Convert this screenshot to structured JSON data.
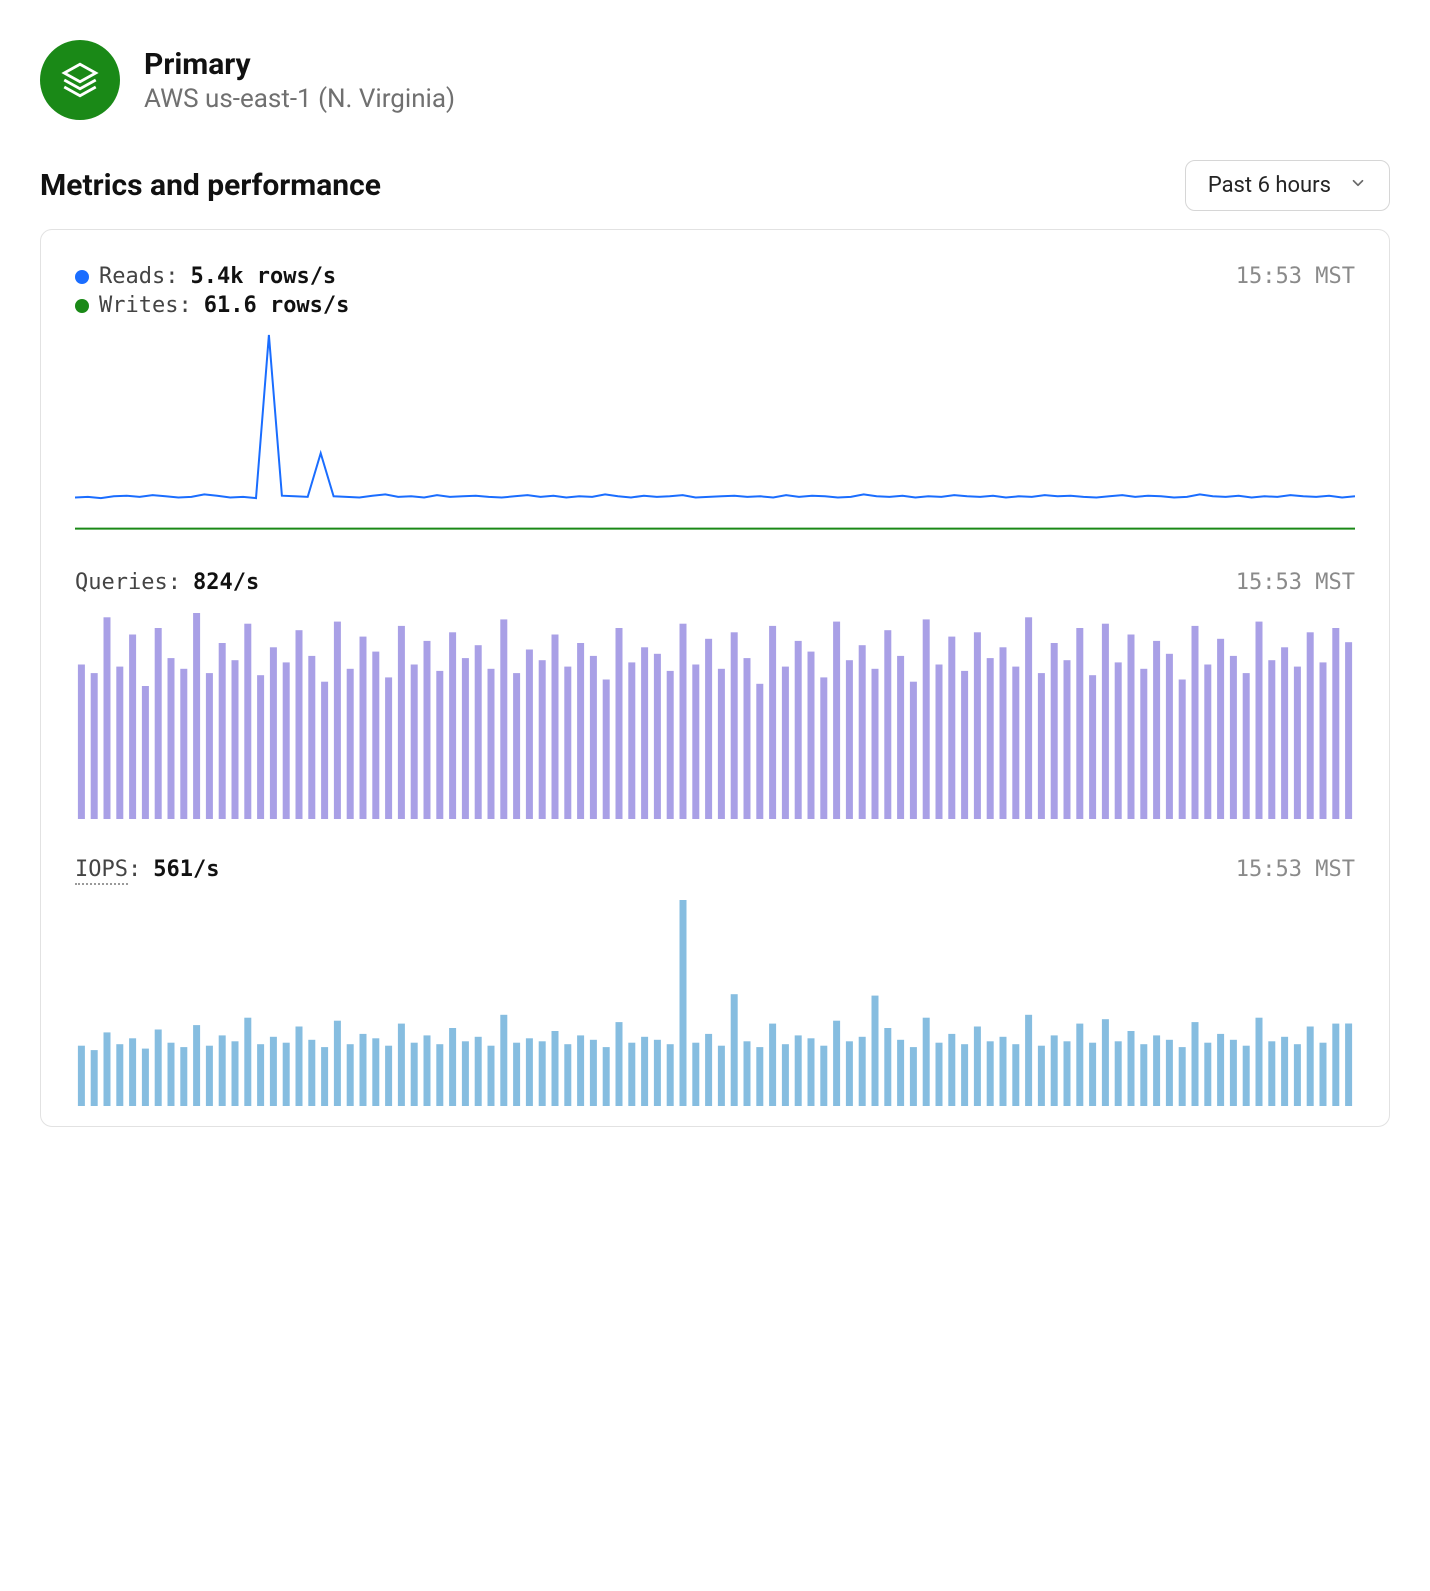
{
  "header": {
    "title": "Primary",
    "subtitle": "AWS us-east-1 (N. Virginia)"
  },
  "section": {
    "title": "Metrics and performance"
  },
  "time_range": {
    "selected": "Past 6 hours"
  },
  "colors": {
    "reads": "#1a6dff",
    "writes": "#1a8917",
    "queries": "#a9a0e6",
    "iops": "#86bde0"
  },
  "charts": {
    "reads_writes": {
      "timestamp": "15:53 MST",
      "legend": [
        {
          "name": "Reads",
          "label": "Reads:",
          "value": "5.4k rows/s",
          "color_key": "reads"
        },
        {
          "name": "Writes",
          "label": "Writes:",
          "value": "61.6 rows/s",
          "color_key": "writes"
        }
      ]
    },
    "queries": {
      "timestamp": "15:53 MST",
      "label": "Queries:",
      "value": "824/s"
    },
    "iops": {
      "timestamp": "15:53 MST",
      "label": "IOPS",
      "label_suffix": ":",
      "value": "561/s"
    }
  },
  "chart_data": [
    {
      "type": "line",
      "title": "Reads / Writes",
      "ylabel": "rows/s",
      "series": [
        {
          "name": "Reads",
          "color": "#1a6dff",
          "values": [
            5.2,
            5.3,
            5.1,
            5.4,
            5.5,
            5.3,
            5.6,
            5.4,
            5.2,
            5.3,
            5.7,
            5.5,
            5.2,
            5.3,
            5.1,
            32.0,
            5.5,
            5.4,
            5.3,
            12.5,
            5.4,
            5.3,
            5.2,
            5.5,
            5.7,
            5.3,
            5.4,
            5.2,
            5.6,
            5.3,
            5.4,
            5.5,
            5.3,
            5.2,
            5.4,
            5.6,
            5.3,
            5.5,
            5.2,
            5.4,
            5.3,
            5.7,
            5.4,
            5.2,
            5.5,
            5.3,
            5.4,
            5.6,
            5.2,
            5.3,
            5.4,
            5.5,
            5.3,
            5.4,
            5.2,
            5.6,
            5.3,
            5.5,
            5.4,
            5.2,
            5.3,
            5.7,
            5.4,
            5.3,
            5.5,
            5.2,
            5.4,
            5.3,
            5.6,
            5.4,
            5.3,
            5.5,
            5.2,
            5.4,
            5.3,
            5.6,
            5.4,
            5.5,
            5.3,
            5.2,
            5.4,
            5.6,
            5.3,
            5.5,
            5.4,
            5.2,
            5.3,
            5.7,
            5.4,
            5.3,
            5.5,
            5.2,
            5.4,
            5.3,
            5.6,
            5.4,
            5.3,
            5.5,
            5.2,
            5.4
          ]
        },
        {
          "name": "Writes",
          "color": "#1a8917",
          "values": [
            60,
            62,
            61,
            63,
            60,
            62,
            61,
            60,
            63,
            62,
            61,
            60,
            62,
            61,
            60,
            63,
            62,
            61,
            60,
            62,
            61,
            63,
            60,
            62,
            61,
            60,
            63,
            62,
            61,
            60,
            62,
            61,
            60,
            63,
            62,
            61,
            60,
            62,
            61,
            63,
            60,
            62,
            61,
            60,
            63,
            62,
            61,
            60,
            62,
            61,
            60,
            63,
            62,
            61,
            60,
            62,
            61,
            63,
            60,
            62,
            61,
            60,
            63,
            62,
            61,
            60,
            62,
            61,
            60,
            63,
            62,
            61,
            60,
            62,
            61,
            63,
            60,
            62,
            61,
            60,
            63,
            62,
            61,
            60,
            62,
            61,
            60,
            63,
            62,
            61,
            60,
            62,
            61,
            63,
            60,
            62,
            61,
            60,
            63,
            62
          ]
        }
      ]
    },
    {
      "type": "bar",
      "title": "Queries",
      "ylabel": "/s",
      "series": [
        {
          "name": "Queries",
          "color": "#a9a0e6",
          "values": [
            720,
            680,
            940,
            710,
            860,
            620,
            890,
            750,
            700,
            960,
            680,
            820,
            740,
            910,
            670,
            800,
            730,
            880,
            760,
            640,
            920,
            700,
            850,
            780,
            660,
            900,
            720,
            830,
            690,
            870,
            750,
            810,
            700,
            930,
            680,
            790,
            740,
            860,
            710,
            820,
            760,
            650,
            890,
            730,
            800,
            770,
            690,
            910,
            720,
            840,
            700,
            870,
            750,
            630,
            900,
            710,
            830,
            780,
            660,
            920,
            740,
            810,
            700,
            880,
            760,
            640,
            930,
            720,
            850,
            690,
            870,
            750,
            800,
            710,
            940,
            680,
            820,
            740,
            890,
            670,
            910,
            730,
            860,
            700,
            830,
            770,
            650,
            900,
            720,
            840,
            760,
            680,
            920,
            740,
            800,
            710,
            870,
            730,
            890,
            824
          ]
        }
      ]
    },
    {
      "type": "bar",
      "title": "IOPS",
      "ylabel": "/s",
      "series": [
        {
          "name": "IOPS",
          "color": "#86bde0",
          "values": [
            410,
            380,
            500,
            420,
            460,
            390,
            520,
            430,
            400,
            550,
            410,
            480,
            440,
            600,
            420,
            470,
            430,
            540,
            450,
            400,
            580,
            420,
            490,
            460,
            410,
            560,
            430,
            480,
            420,
            530,
            440,
            470,
            410,
            620,
            430,
            460,
            440,
            510,
            420,
            480,
            450,
            400,
            570,
            430,
            470,
            450,
            420,
            1400,
            430,
            490,
            410,
            760,
            440,
            400,
            560,
            420,
            480,
            460,
            410,
            580,
            440,
            470,
            750,
            530,
            450,
            400,
            600,
            430,
            490,
            420,
            540,
            440,
            470,
            420,
            620,
            410,
            480,
            440,
            560,
            430,
            590,
            440,
            510,
            420,
            480,
            450,
            400,
            570,
            430,
            490,
            450,
            410,
            600,
            440,
            470,
            420,
            540,
            430,
            560,
            561
          ]
        }
      ]
    }
  ]
}
